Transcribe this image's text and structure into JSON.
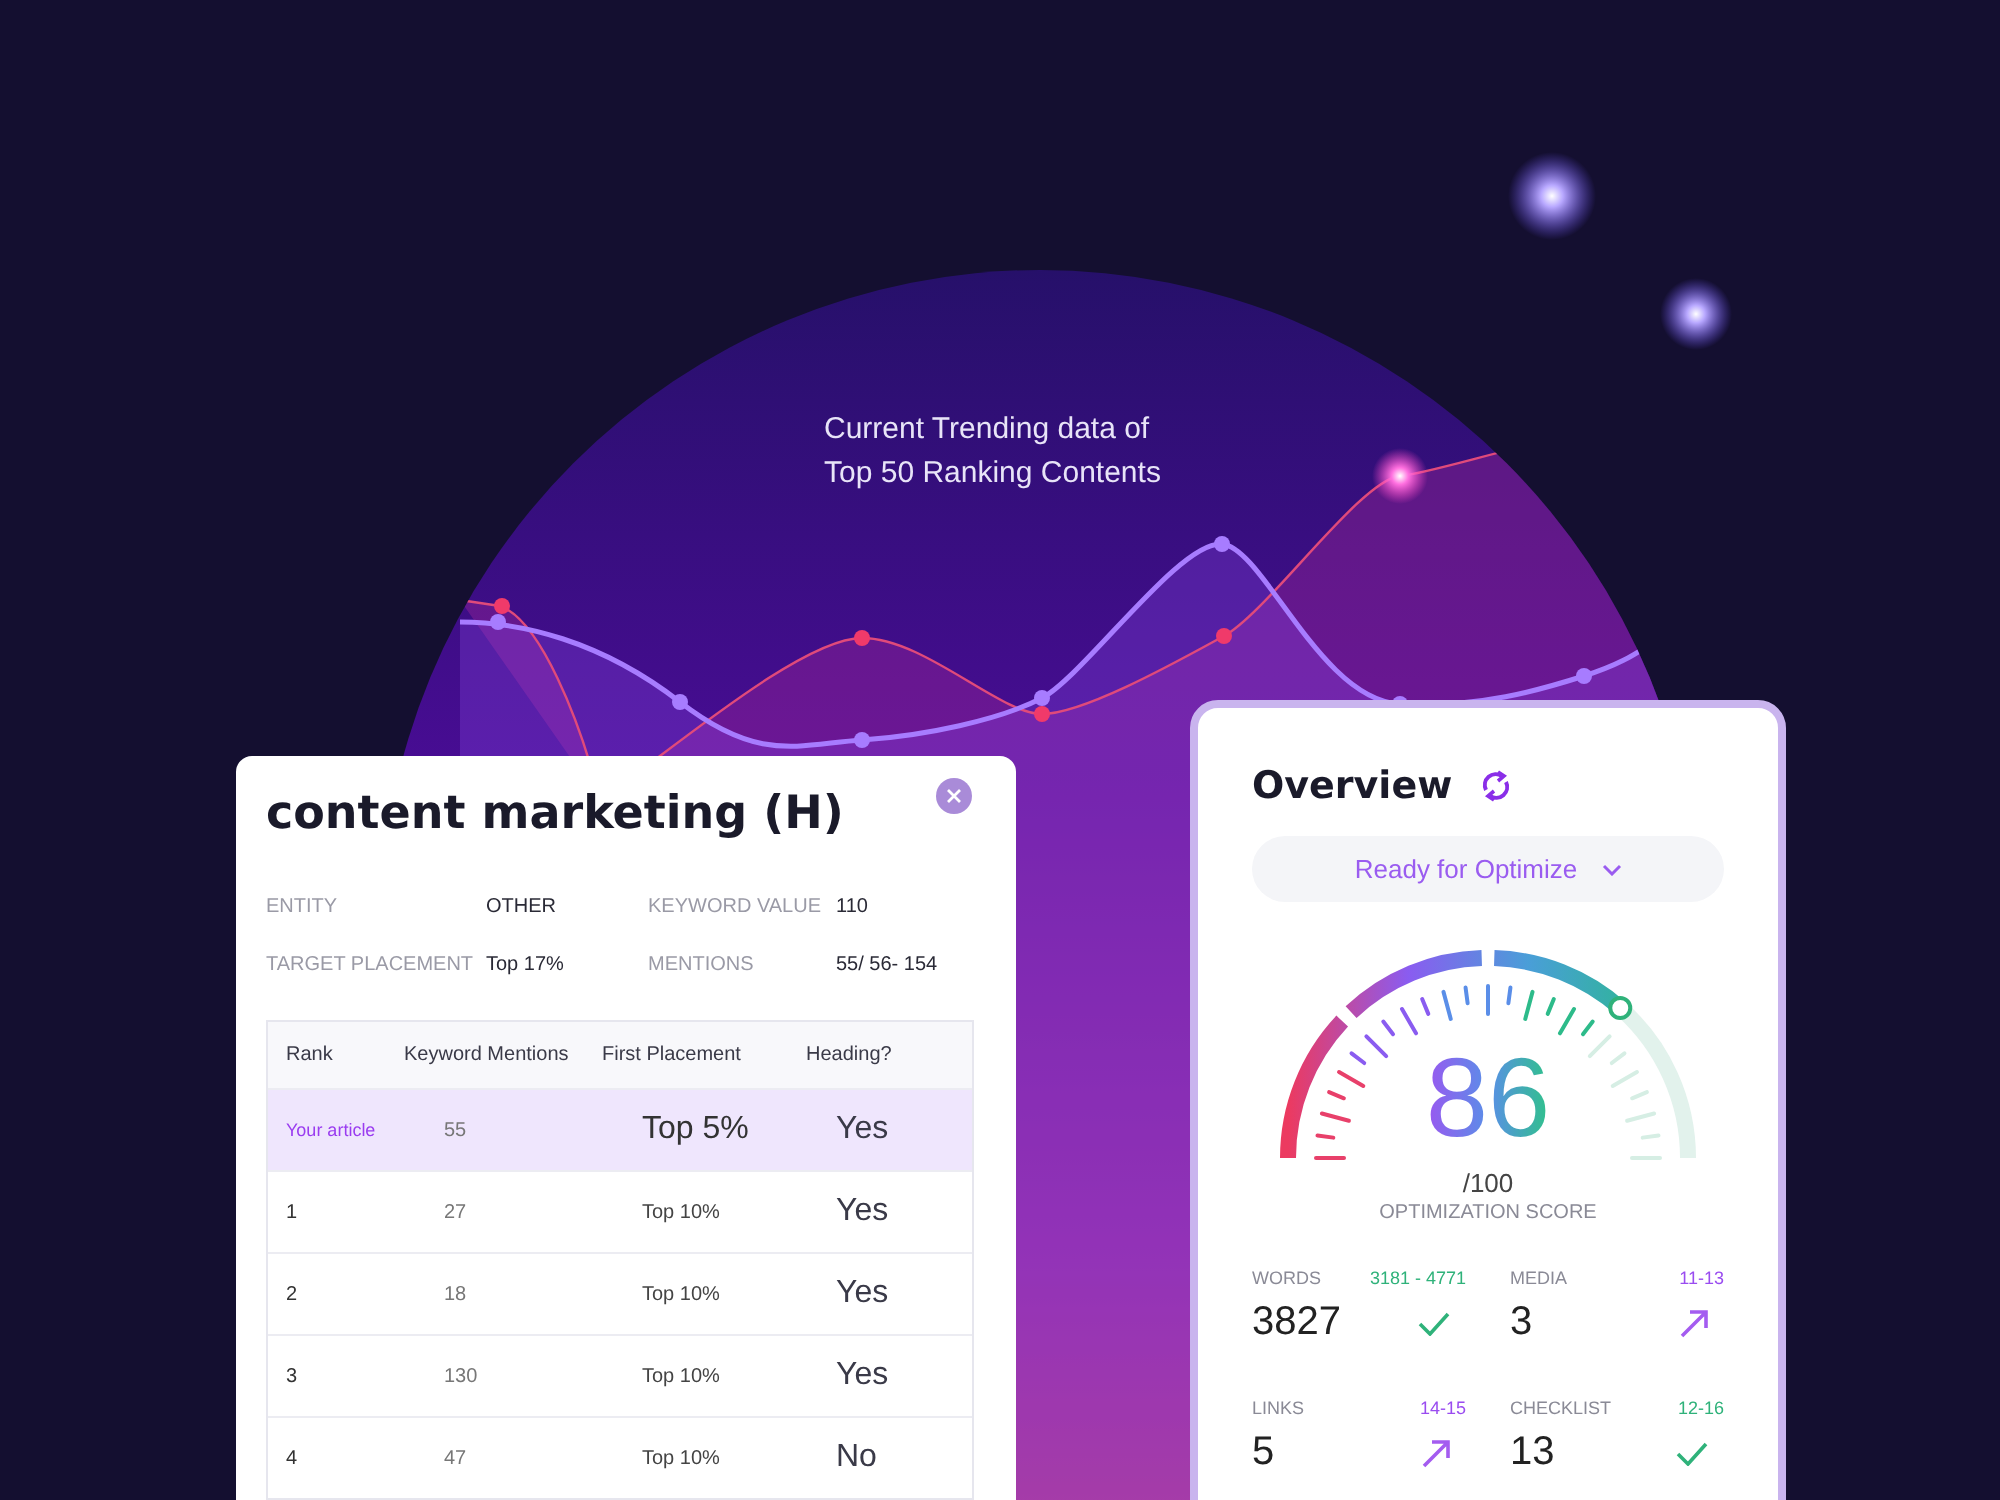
{
  "headline": [
    "Current Trending data of",
    "Top 50 Ranking Contents"
  ],
  "keyword_card": {
    "title": "content marketing (H)",
    "facts": [
      {
        "label": "ENTITY",
        "value": "OTHER"
      },
      {
        "label": "KEYWORD VALUE",
        "value": "110"
      },
      {
        "label": "TARGET PLACEMENT",
        "value": "Top 17%"
      },
      {
        "label": "MENTIONS",
        "value": "55/ 56- 154"
      }
    ],
    "table": {
      "columns": [
        "Rank",
        "Keyword Mentions",
        "First Placement",
        "Heading?"
      ],
      "rows": [
        {
          "cells": [
            "Your article",
            "55",
            "Top 5%",
            "Yes"
          ],
          "selected": true
        },
        {
          "cells": [
            "1",
            "27",
            "Top 10%",
            "Yes"
          ],
          "selected": false
        },
        {
          "cells": [
            "2",
            "18",
            "Top 10%",
            "Yes"
          ],
          "selected": false
        },
        {
          "cells": [
            "3",
            "130",
            "Top 10%",
            "Yes"
          ],
          "selected": false
        },
        {
          "cells": [
            "4",
            "47",
            "Top 10%",
            "No"
          ],
          "selected": false
        }
      ]
    }
  },
  "overview": {
    "title": "Overview",
    "status": "Ready for Optimize",
    "score": "86",
    "score_max": "/100",
    "score_label": "OPTIMIZATION SCORE",
    "metrics": [
      {
        "label": "WORDS",
        "range": "3181 - 4771",
        "value": "3827",
        "kind": "check"
      },
      {
        "label": "MEDIA",
        "range": "11-13",
        "value": "3",
        "kind": "arrow"
      },
      {
        "label": "LINKS",
        "range": "14-15",
        "value": "5",
        "kind": "arrow"
      },
      {
        "label": "CHECKLIST",
        "range": "12-16",
        "value": "13",
        "kind": "check"
      }
    ]
  }
}
